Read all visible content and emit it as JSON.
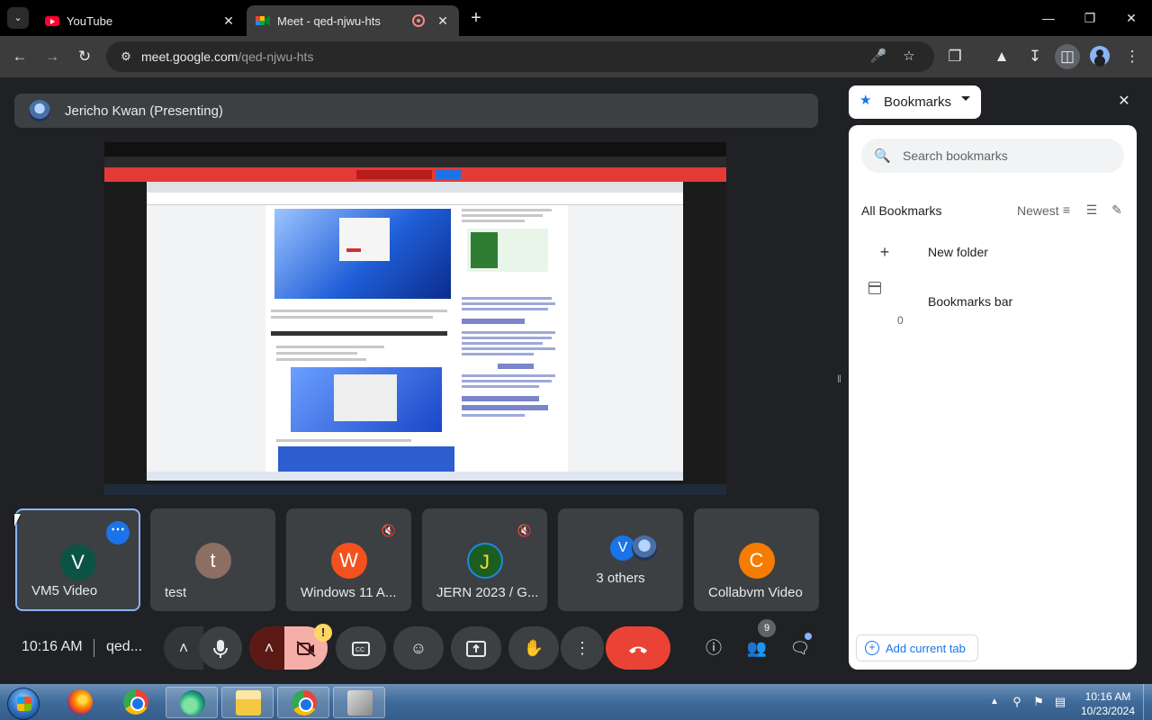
{
  "browser": {
    "tabs": [
      {
        "title": "YouTube",
        "icon": "youtube-icon"
      },
      {
        "title": "Meet - qed-njwu-hts",
        "icon": "google-meet-icon",
        "recording": true
      }
    ],
    "url_host": "meet.google.com",
    "url_path": "/qed-njwu-hts"
  },
  "meet": {
    "presenter_label": "Jericho Kwan (Presenting)",
    "participants": [
      {
        "initial": "V",
        "name": "VM5 Video",
        "color": "#0b5345",
        "active": true
      },
      {
        "initial": "t",
        "name": "test",
        "color": "#8d6e63"
      },
      {
        "initial": "W",
        "name": "Windows 11 A...",
        "color": "#f4511e",
        "muted": true
      },
      {
        "initial": "J",
        "name": "JERN 2023 / G...",
        "color": "#1b5e20",
        "muted": true
      },
      {
        "initial": "V",
        "name": "3 others",
        "color": "#1a73e8"
      },
      {
        "initial": "C",
        "name": "Collabvm Video",
        "color": "#f57c00"
      }
    ],
    "time": "10:16 AM",
    "meeting_code": "qed...",
    "warning_badge": "!",
    "people_count": "9"
  },
  "bookmarks": {
    "title": "Bookmarks",
    "search_placeholder": "Search bookmarks",
    "section_title": "All Bookmarks",
    "sort_label": "Newest",
    "new_folder_label": "New folder",
    "bookmarks_bar_label": "Bookmarks bar",
    "bookmarks_bar_count": "0",
    "add_current_tab_label": "Add current tab"
  },
  "taskbar": {
    "time": "10:16 AM",
    "date": "10/23/2024"
  },
  "colors": {
    "meet_bg": "#202124",
    "tile_bg": "#3c4043",
    "accent": "#1a73e8",
    "hangup": "#ea4335"
  }
}
